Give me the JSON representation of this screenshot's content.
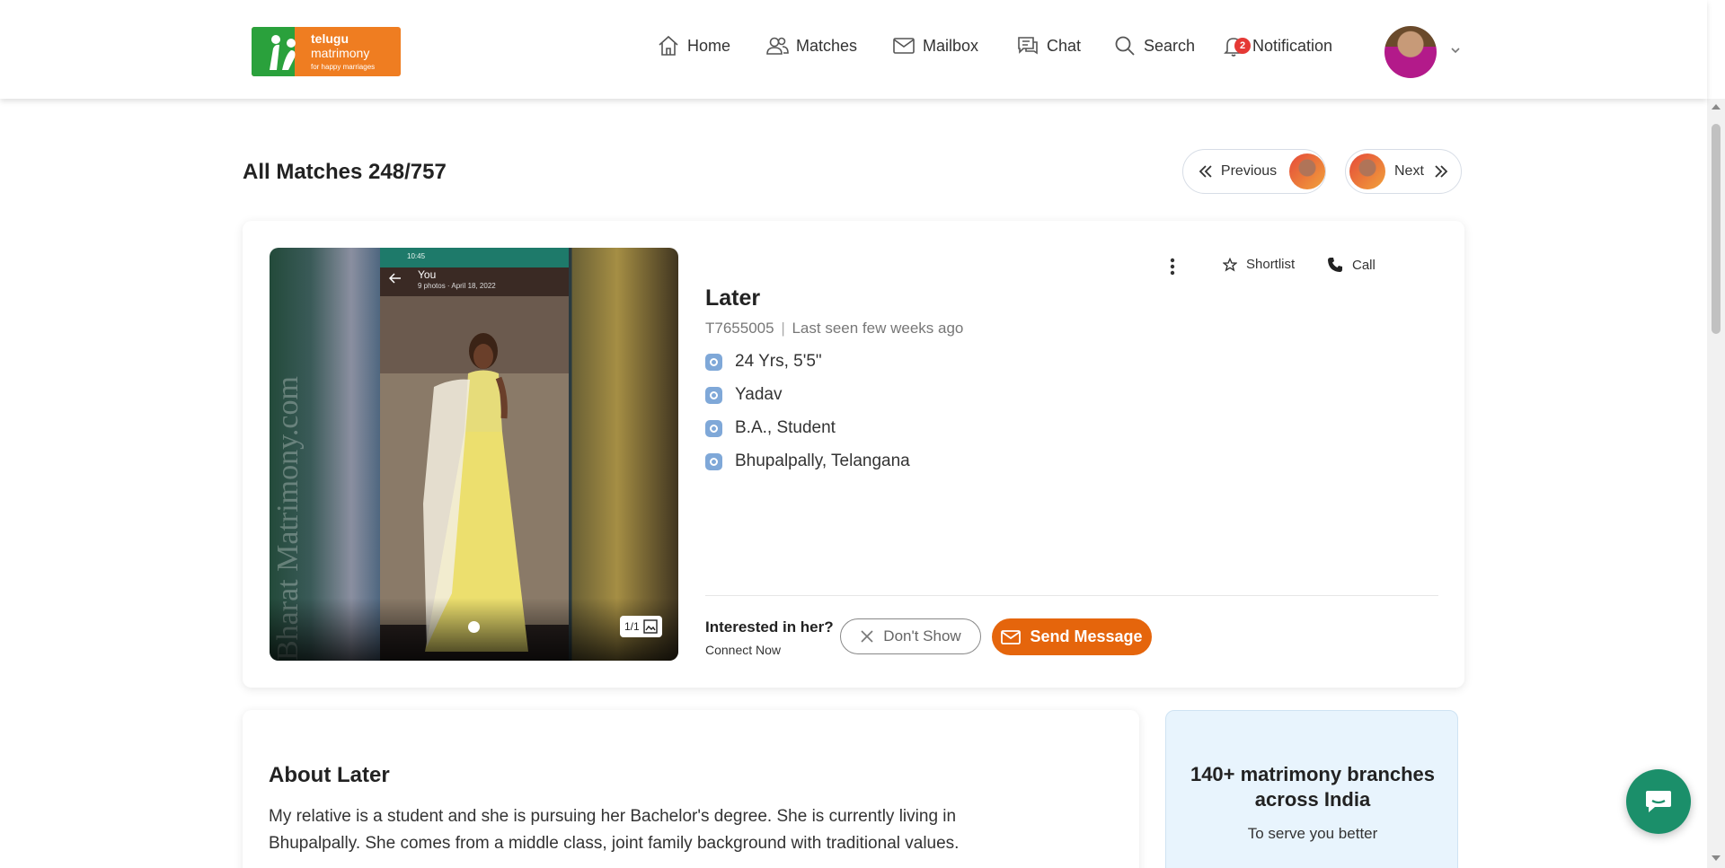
{
  "logo": {
    "line1": "telugu",
    "line2": "matrimony",
    "tagline": "for happy marriages"
  },
  "nav": {
    "home": "Home",
    "matches": "Matches",
    "mailbox": "Mailbox",
    "chat": "Chat",
    "search": "Search",
    "notification": "Notification",
    "notification_count": "2"
  },
  "page": {
    "title": "All Matches 248/757"
  },
  "pager": {
    "previous": "Previous",
    "next": "Next"
  },
  "profile": {
    "name": "Later",
    "id": "T7655005",
    "last_seen": "Last seen few weeks ago",
    "details": {
      "age_height": "24 Yrs, 5'5\"",
      "caste": "Yadav",
      "education": "B.A., Student",
      "location": "Bhupalpally, Telangana"
    },
    "photo": {
      "counter": "1/1",
      "watermark": "Bharat Matrimony.com",
      "phone_time": "10:45",
      "phone_title": "You",
      "phone_subtitle": "9 photos · April 18, 2022"
    }
  },
  "actions": {
    "shortlist": "Shortlist",
    "call": "Call"
  },
  "interest": {
    "question": "Interested in her?",
    "sub": "Connect Now",
    "dont_show": "Don't Show",
    "send_message": "Send Message"
  },
  "about": {
    "title": "About Later",
    "text": "My relative is a student and she is pursuing her Bachelor's degree. She is currently living in Bhupalpally. She comes from a middle class, joint family background with traditional values."
  },
  "branch": {
    "title": "140+ matrimony branches across India",
    "sub": "To serve you better"
  },
  "colors": {
    "accent": "#e5650c",
    "logo_orange": "#ef7d21",
    "logo_green": "#2aa13c",
    "chat_fab": "#1b8f6a",
    "badge": "#e53935"
  }
}
